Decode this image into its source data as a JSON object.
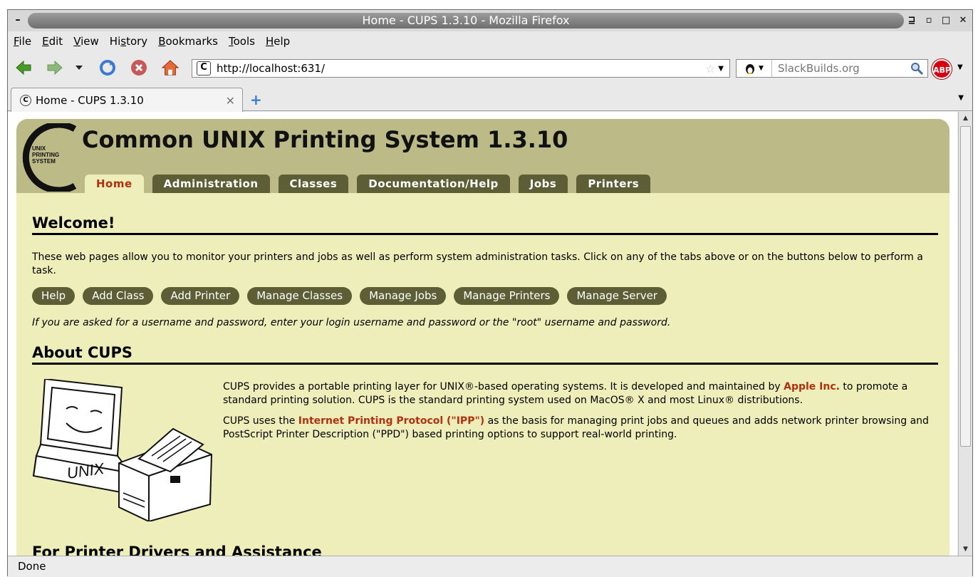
{
  "window": {
    "title": "Home - CUPS 1.3.10 - Mozilla Firefox",
    "menu_glyph": "–",
    "controls": [
      "⊒",
      "▫",
      "□",
      "✕"
    ]
  },
  "menubar": {
    "items": [
      {
        "label": "File",
        "u": "F",
        "rest": "ile"
      },
      {
        "label": "Edit",
        "u": "E",
        "rest": "dit"
      },
      {
        "label": "View",
        "u": "V",
        "rest": "iew"
      },
      {
        "label": "History",
        "pre": "Hi",
        "u": "s",
        "rest": "tory"
      },
      {
        "label": "Bookmarks",
        "u": "B",
        "rest": "ookmarks"
      },
      {
        "label": "Tools",
        "u": "T",
        "rest": "ools"
      },
      {
        "label": "Help",
        "u": "H",
        "rest": "elp"
      }
    ]
  },
  "navbar": {
    "url": "http://localhost:631/",
    "search_placeholder": "SlackBuilds.org",
    "abp_label": "ABP"
  },
  "tab": {
    "title": "Home - CUPS 1.3.10"
  },
  "cups": {
    "site_title": "Common UNIX Printing System 1.3.10",
    "logo_text": [
      "UNIX",
      "PRINTING",
      "SYSTEM"
    ],
    "nav_tabs": [
      "Home",
      "Administration",
      "Classes",
      "Documentation/Help",
      "Jobs",
      "Printers"
    ],
    "active_tab": "Home",
    "welcome_heading": "Welcome!",
    "welcome_text": "These web pages allow you to monitor your printers and jobs as well as perform system administration tasks. Click on any of the tabs above or on the buttons below to perform a task.",
    "buttons": [
      "Help",
      "Add Class",
      "Add Printer",
      "Manage Classes",
      "Manage Jobs",
      "Manage Printers",
      "Manage Server"
    ],
    "login_note": "If you are asked for a username and password, enter your login username and password or the \"root\" username and password.",
    "about_heading": "About CUPS",
    "art_label": "UNIX",
    "about_p1_a": "CUPS provides a portable printing layer for UNIX®-based operating systems. It is developed and maintained by ",
    "about_p1_link": "Apple Inc.",
    "about_p1_b": " to promote a standard printing solution. CUPS is the standard printing system used on MacOS® X and most Linux® distributions.",
    "about_p2_a": "CUPS uses the ",
    "about_p2_link": "Internet Printing Protocol (\"IPP\")",
    "about_p2_b": " as the basis for managing print jobs and queues and adds network printer browsing and PostScript Printer Description (\"PPD\") based printing options to support real-world printing.",
    "drivers_heading": "For Printer Drivers and Assistance"
  },
  "status": "Done",
  "colors": {
    "header": "#bcbb88",
    "page_bg": "#eeeeba",
    "tab_bg": "#5e5e36",
    "link": "#b03010"
  }
}
